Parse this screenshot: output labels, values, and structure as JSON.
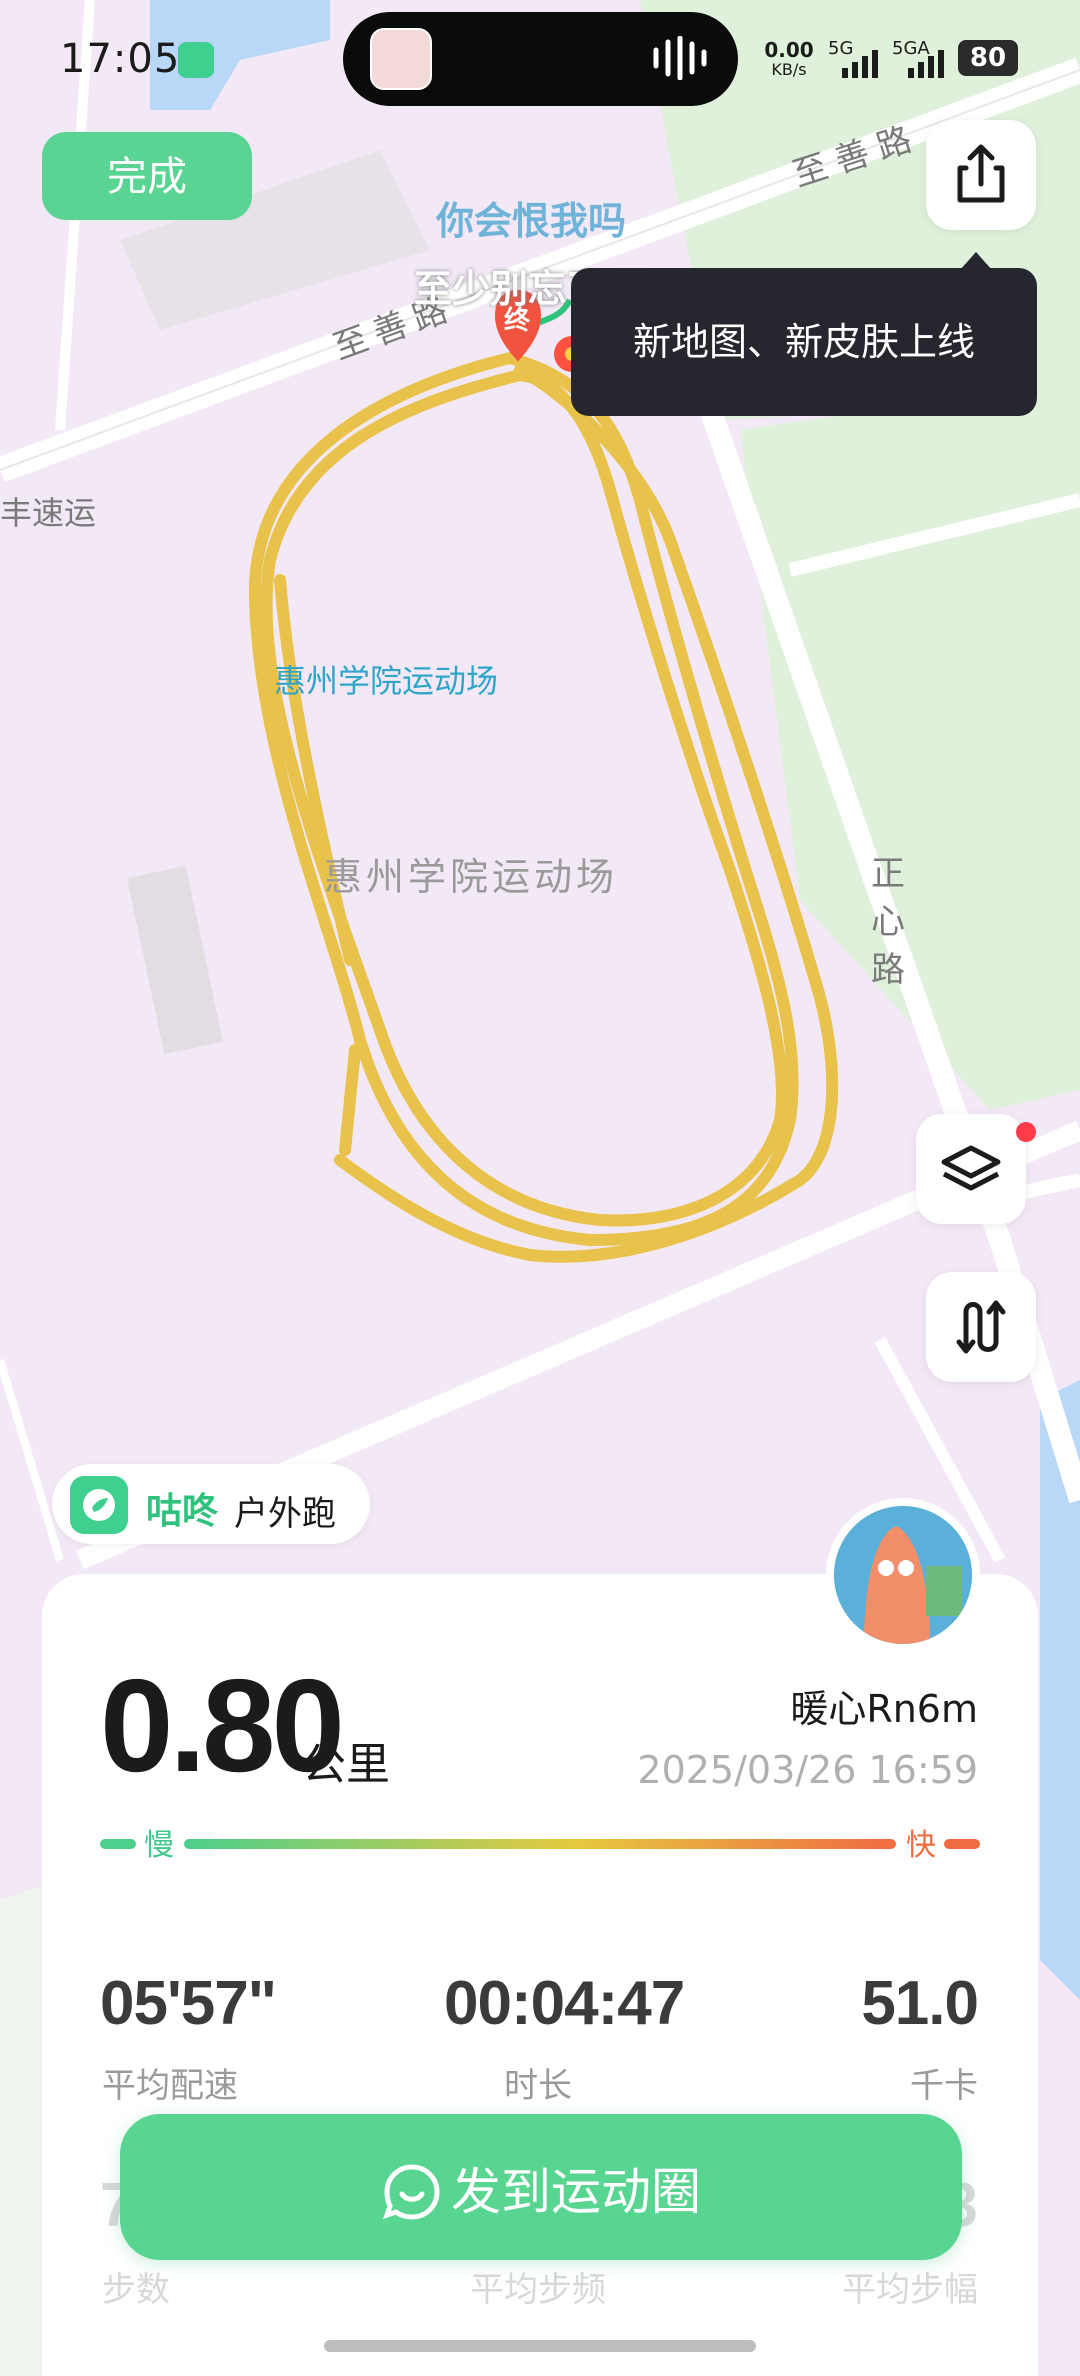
{
  "status_bar": {
    "time": "17:05",
    "net_speed": "0.00",
    "net_unit": "KB/s",
    "sim1": "5G",
    "sim2": "5GA",
    "battery": "80"
  },
  "header": {
    "done_label": "完成",
    "share_icon": "share-icon"
  },
  "map": {
    "tooltip": "新地图、新皮肤上线",
    "track_color": "#e8c24a",
    "labels": {
      "road_top": "至善路",
      "road_left": "至善路",
      "road_right": "正心路",
      "road_side": "丰速运",
      "venue_blue": "惠州学院运动场",
      "venue_grey": "惠州学院运动场",
      "lyric1": "你会恨我吗",
      "lyric2": "至少别忘了吧",
      "end_marker": "终"
    },
    "layer_icon": "layers-icon",
    "route_icon": "route-icon"
  },
  "brand": {
    "name": "咕咚",
    "activity": "户外跑"
  },
  "summary": {
    "distance": "0.80",
    "distance_unit": "公里",
    "username": "暖心Rn6m",
    "datetime": "2025/03/26 16:59",
    "slow_label": "慢",
    "fast_label": "快",
    "pace_colors": [
      "#4cd08b",
      "#e6c93f",
      "#f06b42"
    ]
  },
  "stats": [
    {
      "value": "05'57\"",
      "label": "平均配速"
    },
    {
      "value": "00:04:47",
      "label": "时长"
    },
    {
      "value": "51.0",
      "label": "千卡"
    }
  ],
  "stats_row2": [
    {
      "value": "7",
      "label": "步数"
    },
    {
      "value": "",
      "label": "平均步频"
    },
    {
      "value": "3",
      "label": "平均步幅"
    }
  ],
  "actions": {
    "post_label": "发到运动圈"
  },
  "colors": {
    "accent": "#59d592",
    "tooltip_bg": "#26272e"
  }
}
